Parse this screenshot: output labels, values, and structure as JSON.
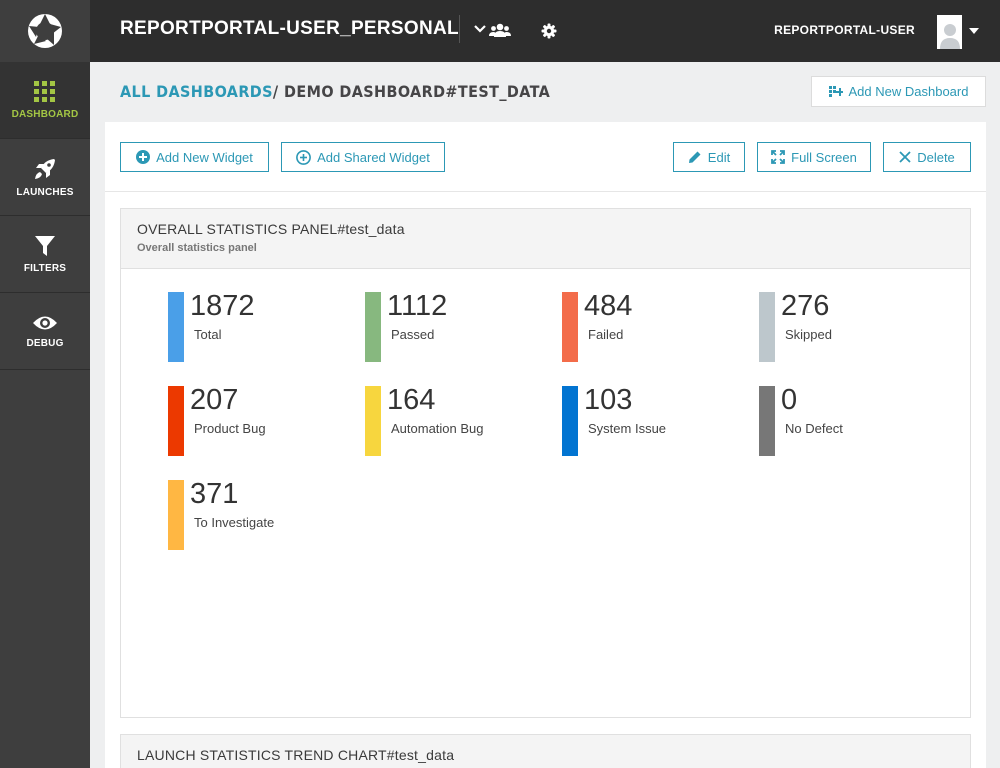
{
  "topbar": {
    "project_name": "REPORTPORTAL-USER_PERSONAL",
    "user_name": "REPORTPORTAL-USER"
  },
  "sidebar": {
    "items": [
      {
        "label": "DASHBOARD",
        "icon": "grid-icon"
      },
      {
        "label": "LAUNCHES",
        "icon": "rocket-icon"
      },
      {
        "label": "FILTERS",
        "icon": "filter-icon"
      },
      {
        "label": "DEBUG",
        "icon": "eye-icon"
      }
    ]
  },
  "breadcrumb": {
    "link": "ALL DASHBOARDS",
    "separator": "/",
    "current": "DEMO DASHBOARD#TEST_DATA"
  },
  "header": {
    "add_dashboard_label": "Add New Dashboard"
  },
  "toolbar": {
    "add_widget_label": "Add New Widget",
    "add_shared_label": "Add Shared Widget",
    "edit_label": "Edit",
    "fullscreen_label": "Full Screen",
    "delete_label": "Delete"
  },
  "widget": {
    "title": "OVERALL STATISTICS PANEL#test_data",
    "subtitle": "Overall statistics panel",
    "stats": [
      {
        "value": "1872",
        "label": "Total",
        "color": "#4a9fe8"
      },
      {
        "value": "1112",
        "label": "Passed",
        "color": "#87b87f"
      },
      {
        "value": "484",
        "label": "Failed",
        "color": "#f36c4a"
      },
      {
        "value": "276",
        "label": "Skipped",
        "color": "#bdc7cc"
      },
      {
        "value": "207",
        "label": "Product Bug",
        "color": "#ec3900"
      },
      {
        "value": "164",
        "label": "Automation Bug",
        "color": "#f7d63e"
      },
      {
        "value": "103",
        "label": "System Issue",
        "color": "#0274d1"
      },
      {
        "value": "0",
        "label": "No Defect",
        "color": "#777777"
      },
      {
        "value": "371",
        "label": "To Investigate",
        "color": "#ffb743"
      }
    ]
  },
  "widget2": {
    "title": "LAUNCH STATISTICS TREND CHART#test_data"
  }
}
